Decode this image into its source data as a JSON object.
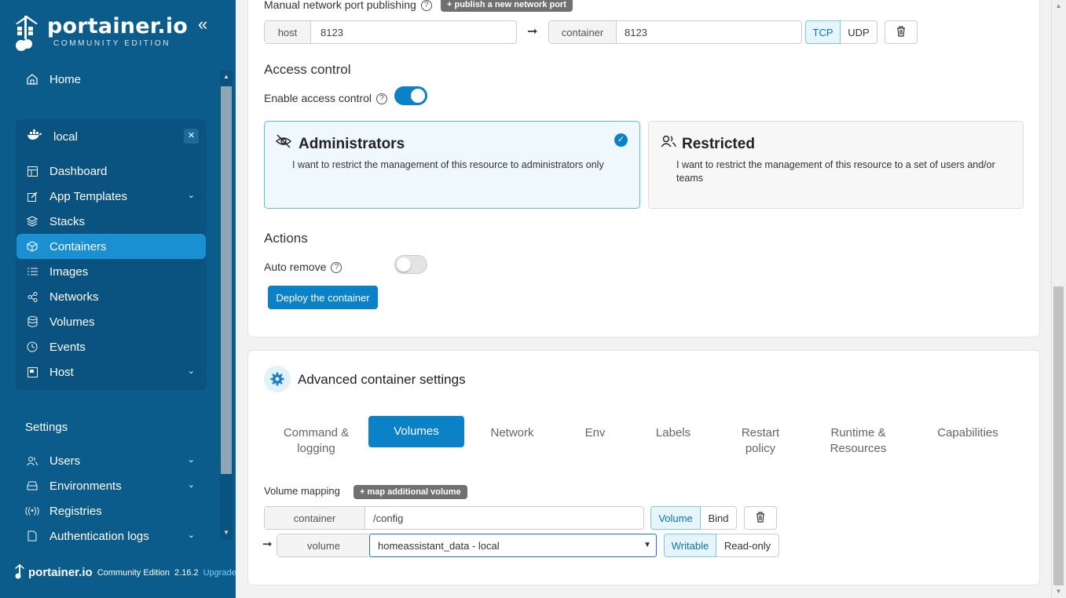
{
  "sidebar": {
    "logo": {
      "name": "portainer.io",
      "edition": "COMMUNITY EDITION"
    },
    "home_label": "Home",
    "environment": {
      "name": "local"
    },
    "env_items": [
      {
        "label": "Dashboard"
      },
      {
        "label": "App Templates"
      },
      {
        "label": "Stacks"
      },
      {
        "label": "Containers"
      },
      {
        "label": "Images"
      },
      {
        "label": "Networks"
      },
      {
        "label": "Volumes"
      },
      {
        "label": "Events"
      },
      {
        "label": "Host"
      }
    ],
    "settings_label": "Settings",
    "settings_items": [
      {
        "label": "Users"
      },
      {
        "label": "Environments"
      },
      {
        "label": "Registries"
      },
      {
        "label": "Authentication logs"
      }
    ],
    "footer": {
      "brand": "portainer.io",
      "edition": "Community Edition",
      "version": "2.16.2",
      "upgrade": "Upgrade"
    }
  },
  "ports": {
    "label": "Manual network port publishing",
    "add_button": "+ publish a new network port",
    "host_addon": "host",
    "host_value": "8123",
    "container_addon": "container",
    "container_value": "8123",
    "protocols": [
      "TCP",
      "UDP"
    ],
    "active_protocol": "TCP"
  },
  "access": {
    "heading": "Access control",
    "toggle_label": "Enable access control",
    "enabled": true,
    "options": [
      {
        "title": "Administrators",
        "desc": "I want to restrict the management of this resource to administrators only",
        "selected": true
      },
      {
        "title": "Restricted",
        "desc": "I want to restrict the management of this resource to a set of users and/or teams",
        "selected": false
      }
    ]
  },
  "actions": {
    "heading": "Actions",
    "auto_remove_label": "Auto remove",
    "auto_remove": false,
    "deploy_button": "Deploy the container"
  },
  "advanced": {
    "title": "Advanced container settings",
    "tabs": [
      {
        "label": "Command & logging"
      },
      {
        "label": "Volumes"
      },
      {
        "label": "Network"
      },
      {
        "label": "Env"
      },
      {
        "label": "Labels"
      },
      {
        "label": "Restart policy"
      },
      {
        "label": "Runtime & Resources"
      },
      {
        "label": "Capabilities"
      }
    ],
    "active_tab": "Volumes",
    "volume_mapping_label": "Volume mapping",
    "map_button": "+ map additional volume",
    "container_addon": "container",
    "container_path": "/config",
    "type_options": [
      "Volume",
      "Bind"
    ],
    "active_type": "Volume",
    "volume_addon": "volume",
    "volume_selected": "homeassistant_data - local",
    "mode_options": [
      "Writable",
      "Read-only"
    ],
    "active_mode": "Writable"
  },
  "colors": {
    "sidebar": "#0b5c8a",
    "accent": "#0b82c8",
    "active_nav": "#1a8fd1"
  }
}
